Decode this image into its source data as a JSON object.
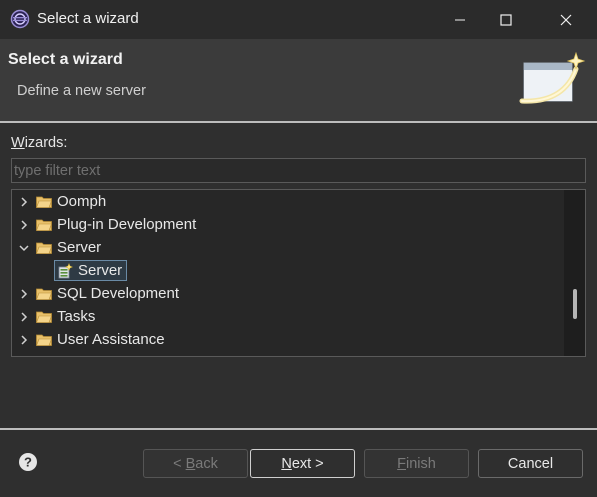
{
  "window": {
    "title": "Select a wizard"
  },
  "header": {
    "title": "Select a wizard",
    "subtitle": "Define a new server"
  },
  "wizards": {
    "label_mnemonic": "W",
    "label_rest": "izards:",
    "filter_placeholder": "type filter text",
    "filter_value": ""
  },
  "tree": {
    "items": [
      {
        "label": "Oomph",
        "expanded": false
      },
      {
        "label": "Plug-in Development",
        "expanded": false
      },
      {
        "label": "Server",
        "expanded": true
      },
      {
        "label": "SQL Development",
        "expanded": false
      },
      {
        "label": "Tasks",
        "expanded": false
      },
      {
        "label": "User Assistance",
        "expanded": false
      }
    ],
    "selected_child": {
      "label": "Server",
      "parent": "Server"
    }
  },
  "buttons": {
    "back": {
      "prefix": "< ",
      "mnemonic": "B",
      "rest": "ack",
      "enabled": false
    },
    "next": {
      "mnemonic": "N",
      "rest": "ext >",
      "enabled": true
    },
    "finish": {
      "mnemonic": "F",
      "rest": "inish",
      "enabled": false
    },
    "cancel": {
      "label": "Cancel",
      "enabled": true
    }
  },
  "icons": {
    "app": "eclipse-icon",
    "minimize": "minimize-icon",
    "maximize": "maximize-icon",
    "close": "close-icon",
    "banner": "wizard-banner-icon",
    "folder": "folder-icon",
    "expand": "chevron-right-icon",
    "collapse": "chevron-down-icon",
    "server": "server-wizard-icon",
    "help": "help-icon"
  },
  "colors": {
    "background": "#2f2f2f",
    "header_background": "#3b3b3b",
    "tree_background": "#272727",
    "folder": "#e8c06a",
    "selection_border": "#6a8aa5"
  }
}
